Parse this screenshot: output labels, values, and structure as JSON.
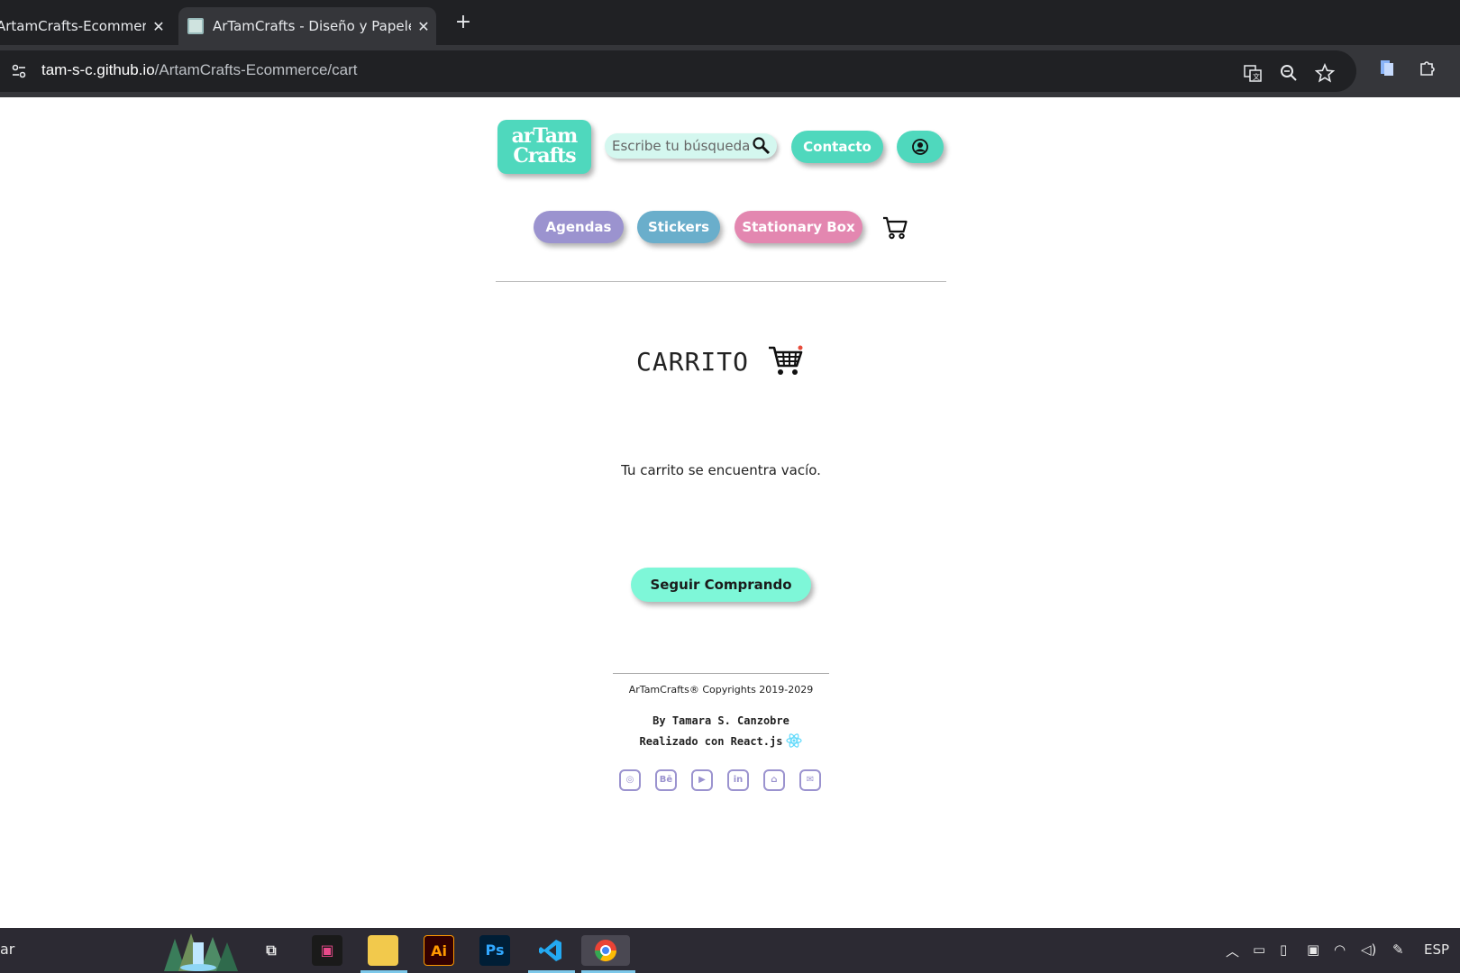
{
  "browser": {
    "tabs": [
      {
        "title": "ArtamCrafts-Ecommer",
        "active": false
      },
      {
        "title": "ArTamCrafts - Diseño y Papelerí",
        "active": true
      }
    ],
    "new_tab": "+",
    "close_glyph": "✕",
    "url_host": "tam-s-c.github.io",
    "url_path": "/ArtamCrafts-Ecommerce/cart"
  },
  "header": {
    "logo_line1": "arTam",
    "logo_line2": "Crafts",
    "search_placeholder": "Escribe tu búsqueda...",
    "contact_label": "Contacto"
  },
  "nav": {
    "items": [
      {
        "label": "Agendas",
        "color": "#9b93cf"
      },
      {
        "label": "Stickers",
        "color": "#6aaecb"
      },
      {
        "label": "Stationary Box",
        "color": "#e387b0"
      }
    ]
  },
  "cart": {
    "title": "CARRITO",
    "empty_message": "Tu carrito se encuentra vacío.",
    "continue_label": "Seguir Comprando"
  },
  "footer": {
    "copyright": "ArTamCrafts® Copyrights 2019-2029",
    "author": "By Tamara S. Canzobre",
    "built_with": "Realizado con React.js",
    "socials": [
      {
        "name": "instagram-icon",
        "glyph": "◎"
      },
      {
        "name": "behance-icon",
        "glyph": "Bē"
      },
      {
        "name": "youtube-icon",
        "glyph": "▶"
      },
      {
        "name": "linkedin-icon",
        "glyph": "in"
      },
      {
        "name": "github-icon",
        "glyph": "⌂"
      },
      {
        "name": "mail-icon",
        "glyph": "✉"
      }
    ]
  },
  "taskbar": {
    "search_text": "ar",
    "apps": [
      {
        "name": "task-view-icon",
        "glyph": "⧉"
      },
      {
        "name": "media-app-icon",
        "glyph": "▣"
      },
      {
        "name": "file-explorer-icon",
        "glyph": "📁"
      },
      {
        "name": "illustrator-icon",
        "glyph": "Ai"
      },
      {
        "name": "photoshop-icon",
        "glyph": "Ps"
      },
      {
        "name": "vscode-icon",
        "glyph": "❮❯"
      },
      {
        "name": "chrome-icon",
        "glyph": "◉"
      }
    ],
    "language": "ESP"
  },
  "colors": {
    "accent": "#4fd8bd",
    "continue_button": "#7ef7d8",
    "social_icon": "#9b93cf"
  }
}
